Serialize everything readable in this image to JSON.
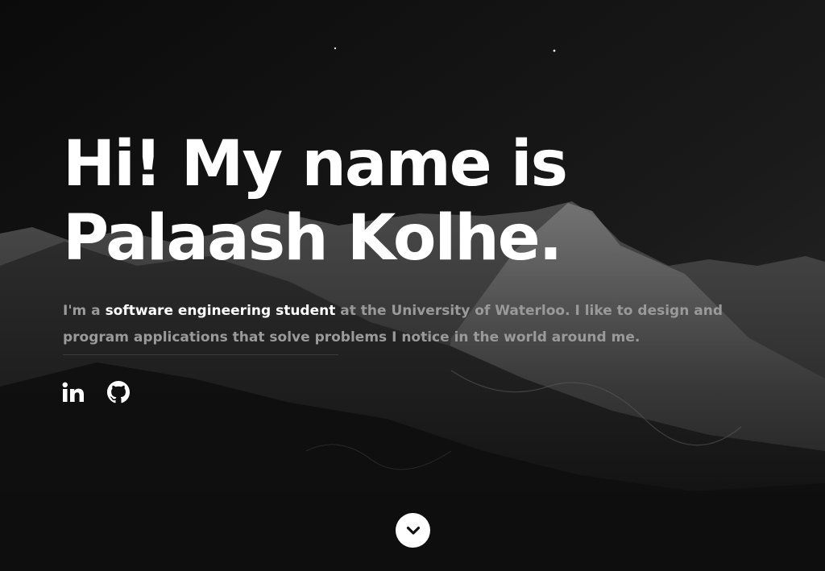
{
  "hero": {
    "headline_line1": "Hi! My name is",
    "headline_line2": "Palaash Kolhe.",
    "intro_prefix": "I'm a ",
    "intro_emphasis": "software engineering student",
    "intro_suffix": " at the University of Waterloo. I like to design and program applications that solve problems I notice in the world around me."
  },
  "social": {
    "linkedin_icon": "linkedin-icon",
    "github_icon": "github-icon"
  },
  "scroll": {
    "icon": "chevron-down-icon"
  },
  "colors": {
    "background": "#0d0d0d",
    "headline": "#ffffff",
    "intro_text": "#9a9a9a",
    "emphasis": "#ffffff"
  }
}
